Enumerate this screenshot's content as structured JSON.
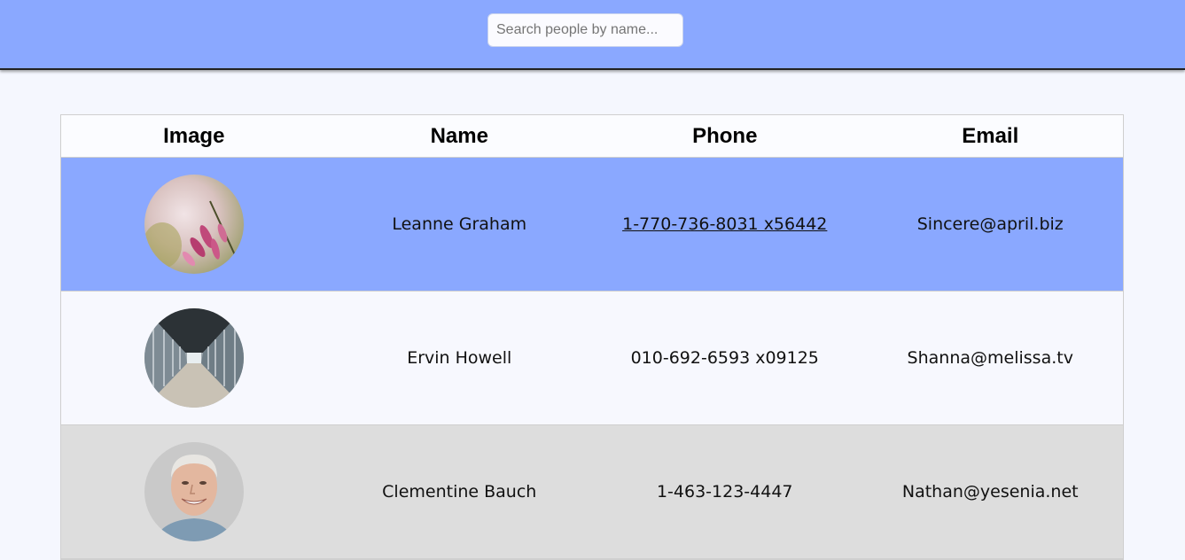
{
  "search": {
    "placeholder": "Search people by name..."
  },
  "table": {
    "headers": [
      "Image",
      "Name",
      "Phone",
      "Email"
    ],
    "rows": [
      {
        "name": "Leanne Graham",
        "phone": "1-770-736-8031 x56442",
        "email": "Sincere@april.biz",
        "image": "flower-photo"
      },
      {
        "name": "Ervin Howell",
        "phone": "010-692-6593 x09125",
        "email": "Shanna@melissa.tv",
        "image": "corridor-photo"
      },
      {
        "name": "Clementine Bauch",
        "phone": "1-463-123-4447",
        "email": "Nathan@yesenia.net",
        "image": "portrait-photo"
      }
    ]
  },
  "colors": {
    "header_bar": "#8aa8ff",
    "selected_row": "#8aa8ff",
    "alt_row": "#dddddd",
    "page_bg": "#f5f7fe"
  }
}
